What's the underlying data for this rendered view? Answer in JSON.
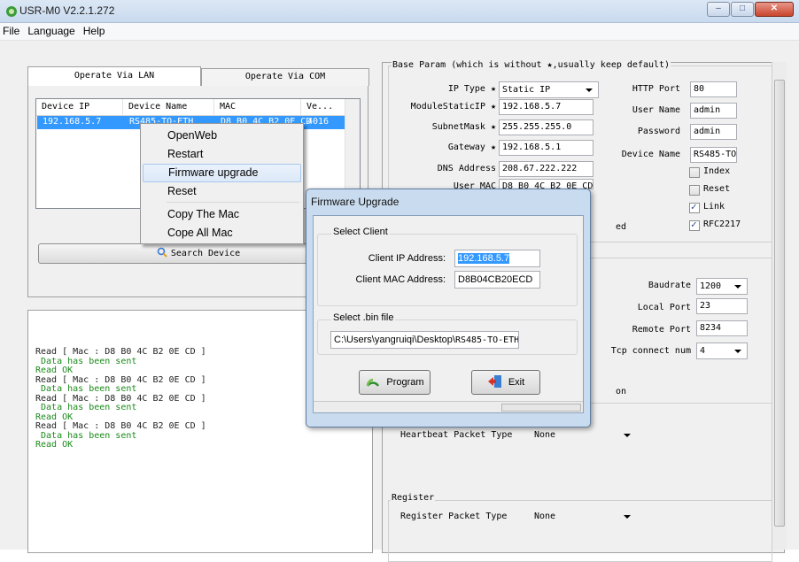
{
  "window": {
    "title": "USR-M0 V2.2.1.272"
  },
  "menubar": [
    "File",
    "Language",
    "Help"
  ],
  "tabs": [
    {
      "label": "Operate Via LAN",
      "active": true
    },
    {
      "label": "Operate Via COM",
      "active": false
    }
  ],
  "device_list": {
    "columns": [
      "Device IP",
      "Device Name",
      "MAC",
      "Ve..."
    ],
    "rows": [
      {
        "ip": "192.168.5.7",
        "name": "RS485-TO-ETH",
        "mac": "D8 B0 4C B2 0E CD",
        "ver": "4016",
        "selected": true
      }
    ]
  },
  "context_menu": {
    "items": [
      "OpenWeb",
      "Restart",
      "Firmware upgrade",
      "Reset",
      "Copy The Mac",
      "Cope All Mac"
    ],
    "highlighted": "Firmware upgrade"
  },
  "search_button": "Search Device",
  "log": [
    {
      "text": "Read [ Mac : D8 B0 4C B2 0E CD ]",
      "kind": "read"
    },
    {
      "text": " Data has been sent",
      "kind": "sent"
    },
    {
      "text": "Read OK",
      "kind": "ok"
    },
    {
      "text": "Read [ Mac : D8 B0 4C B2 0E CD ]",
      "kind": "read"
    },
    {
      "text": " Data has been sent",
      "kind": "sent"
    },
    {
      "text": "Read [ Mac : D8 B0 4C B2 0E CD ]",
      "kind": "read"
    },
    {
      "text": " Data has been sent",
      "kind": "sent"
    },
    {
      "text": "Read OK",
      "kind": "ok"
    },
    {
      "text": "Read [ Mac : D8 B0 4C B2 0E CD ]",
      "kind": "read"
    },
    {
      "text": " Data has been sent",
      "kind": "sent"
    },
    {
      "text": "Read OK",
      "kind": "ok"
    }
  ],
  "settings": {
    "base_param_label": "Base Param (which is without ★,usually keep default)",
    "ip_type": {
      "label": "IP Type ★",
      "value": "Static IP"
    },
    "module_static_ip": {
      "label": "ModuleStaticIP ★",
      "value": "192.168.5.7"
    },
    "subnet_mask": {
      "label": "SubnetMask ★",
      "value": "255.255.255.0"
    },
    "gateway": {
      "label": "Gateway ★",
      "value": "192.168.5.1"
    },
    "dns_address": {
      "label": "DNS Address",
      "value": "208.67.222.222"
    },
    "user_mac": {
      "label": "User MAC",
      "value": "D8 B0 4C B2 0E CD"
    },
    "partial_text_1": "ed",
    "http_port": {
      "label": "HTTP Port",
      "value": "80"
    },
    "user_name": {
      "label": "User Name",
      "value": "admin"
    },
    "password": {
      "label": "Password",
      "value": "admin"
    },
    "device_name": {
      "label": "Device Name",
      "value": "RS485-TO-"
    },
    "checkboxes": [
      {
        "label": "Index",
        "checked": false
      },
      {
        "label": "Reset",
        "checked": false
      },
      {
        "label": "Link",
        "checked": true
      },
      {
        "label": "RFC2217",
        "checked": true
      }
    ],
    "baudrate": {
      "label": "Baudrate",
      "value": "1200"
    },
    "local_port": {
      "label": "Local Port",
      "value": "23"
    },
    "remote_port": {
      "label": "Remote Port",
      "value": "8234"
    },
    "tcp_connect_num": {
      "label": "Tcp connect num",
      "value": "4"
    },
    "partial_text_2": "on",
    "heartbeat_packet_type": {
      "label": "Heartbeat Packet Type",
      "value": "None"
    },
    "register_group_label": "Register",
    "register_packet_type": {
      "label": "Register Packet Type",
      "value": "None"
    }
  },
  "firmware_dialog": {
    "title": "Firmware Upgrade",
    "select_client_label": "Select Client",
    "client_ip_label": "Client IP Address:",
    "client_ip_value": "192.168.5.7",
    "client_mac_label": "Client MAC Address:",
    "client_mac_value": "D8B04CB20ECD",
    "bin_label": "Select .bin file",
    "bin_path_prefix": "C:\\Users\\yangruiqi\\Desktop\\",
    "bin_path_file": "RS485-TO-ETH",
    "program_button": "Program",
    "exit_button": "Exit"
  }
}
